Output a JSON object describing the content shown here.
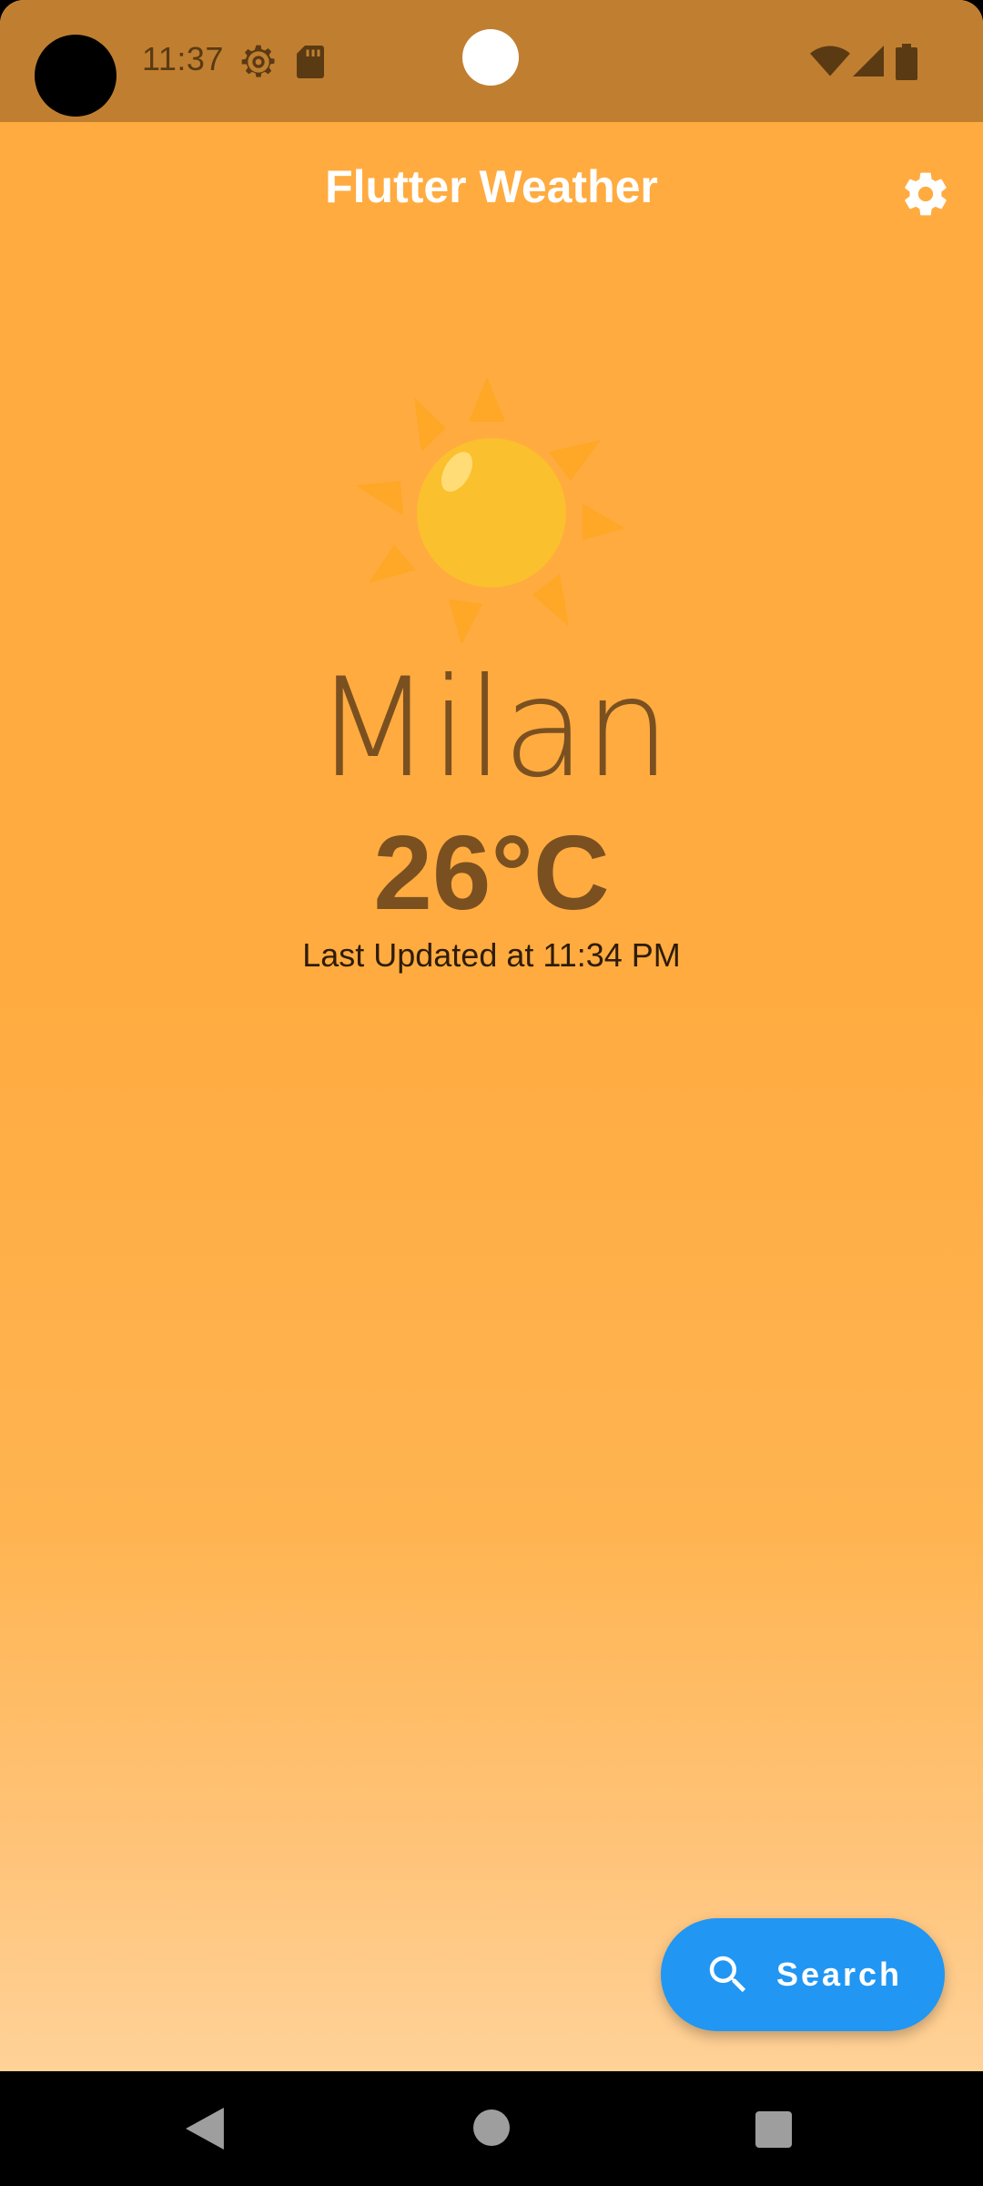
{
  "status_bar": {
    "time": "11:37",
    "icons": [
      "settings-gear-icon",
      "sd-card-icon",
      "wifi-icon",
      "signal-icon",
      "battery-icon"
    ]
  },
  "app_bar": {
    "title": "Flutter Weather",
    "settings_icon": "gear-icon"
  },
  "weather": {
    "condition_icon": "sun-icon",
    "city": "Milan",
    "temperature": "26°C",
    "last_updated": "Last Updated at 11:34 PM"
  },
  "fab": {
    "label": "Search",
    "icon": "search-icon",
    "color": "#2196F3"
  },
  "nav_bar": {
    "buttons": [
      "back-icon",
      "home-icon",
      "recents-icon"
    ]
  },
  "colors": {
    "background_top": "#FFAB40",
    "background_bottom": "#FFD9A8",
    "status_bar": "#C07F30",
    "text_primary": "#7A5020"
  }
}
